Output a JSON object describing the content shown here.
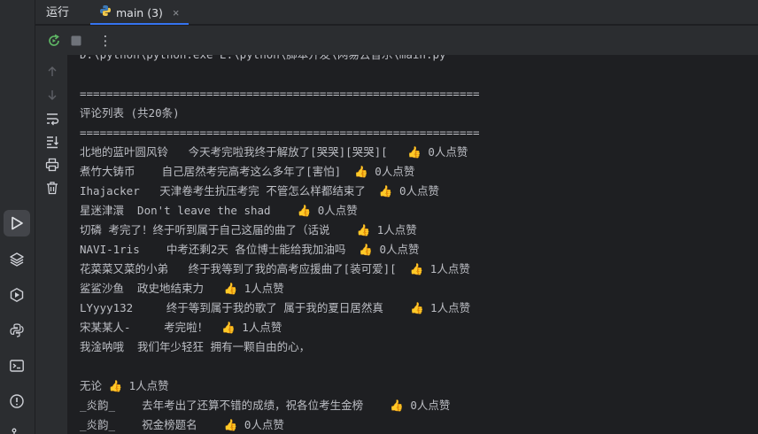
{
  "tabbar": {
    "run_title": "运行",
    "tab_label": "main (3)",
    "tab_close": "×"
  },
  "toolbar": {
    "rerun_icon": "rerun-icon",
    "stop_icon": "stop-icon",
    "more_icon": "more-vertical-icon",
    "more_glyph": "⋮"
  },
  "gutter": {
    "icons": [
      "arrow-up-icon",
      "arrow-down-icon",
      "soft-wrap-icon",
      "scroll-to-end-icon",
      "print-icon",
      "trash-icon"
    ]
  },
  "left_strip": {
    "icons": [
      "run-icon",
      "layers-icon",
      "services-icon",
      "python-console-icon",
      "terminal-icon",
      "problems-icon",
      "git-icon"
    ]
  },
  "console": {
    "lines": [
      "D:\\python\\python.exe E:\\python\\脚本开发\\网易云音乐\\main.py",
      "",
      "============================================================",
      "评论列表 (共20条)",
      "============================================================",
      "北地的蓝叶圆风铃   今天考完啦我终于解放了[哭哭][哭哭][   👍 0人点赞",
      "煮竹大铸币    自己居然考完高考这么多年了[害怕]  👍 0人点赞",
      "Ihajacker   天津卷考生抗压考完 不管怎么样都结束了  👍 0人点赞",
      "星迷津澴  Don't leave the shad    👍 0人点赞",
      "切磷 考完了！终于听到属于自己这届的曲了（话说    👍 1人点赞",
      "NAVI-1ris    中考还剩2天 各位博士能给我加油吗  👍 0人点赞",
      "花菜菜又菜的小弟   终于我等到了我的高考应援曲了[装可爱][  👍 1人点赞",
      "鲨鲨沙鱼  政史地结束力   👍 1人点赞",
      "LYyyy132     终于等到属于我的歌了 属于我的夏日居然真    👍 1人点赞",
      "宋某某人-     考完啦！  👍 1人点赞",
      "我淦呐哦  我们年少轻狂 拥有一颗自由的心，",
      "",
      "无论 👍 1人点赞",
      "_炎韵_    去年考出了还算不错的成绩，祝各位考生金榜    👍 0人点赞",
      "_炎韵_    祝金榜题名    👍 0人点赞"
    ]
  }
}
